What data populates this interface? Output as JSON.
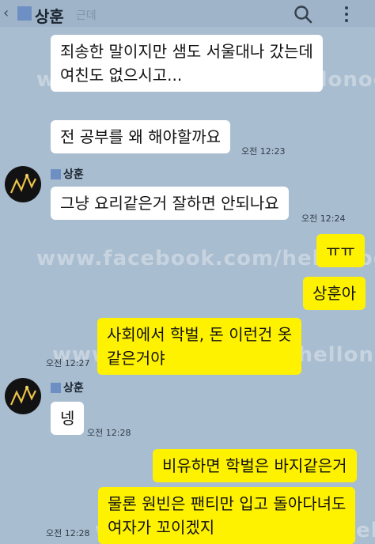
{
  "header": {
    "title": "상훈",
    "subtitle": "근데",
    "back_icon": "chevron-left-icon",
    "search_icon": "search-icon",
    "menu_icon": "more-vertical-icon"
  },
  "watermark": "www.facebook.com/hellonodap",
  "messages": [
    {
      "side": "left",
      "lines": [
        "죄송한 말이지만 샘도 서울대나 갔는데",
        "여친도 없으시고..."
      ],
      "time": ""
    },
    {
      "side": "left",
      "lines": [
        "전 공부를 왜 해야할까요"
      ],
      "time": "오전 12:23"
    },
    {
      "side": "left",
      "sender": "상훈",
      "lines": [
        "그냥 요리같은거 잘하면 안되나요"
      ],
      "time": "오전 12:24"
    },
    {
      "side": "right",
      "lines": [
        "ㅠㅠ"
      ],
      "time": ""
    },
    {
      "side": "right",
      "lines": [
        "상훈아"
      ],
      "time": ""
    },
    {
      "side": "right",
      "lines": [
        "사회에서 학벌, 돈 이런건 옷",
        "같은거야"
      ],
      "time": "오전 12:27"
    },
    {
      "side": "left",
      "sender": "상훈",
      "lines": [
        "넹"
      ],
      "time": "오전 12:28"
    },
    {
      "side": "right",
      "lines": [
        "비유하면 학벌은 바지같은거"
      ],
      "time": ""
    },
    {
      "side": "right",
      "lines": [
        "물론 원빈은 팬티만 입고 돌아다녀도",
        "여자가 꼬이겠지"
      ],
      "time": "오전 12:28"
    }
  ],
  "colors": {
    "background": "#a9bdd0",
    "my_bubble": "#fff200",
    "their_bubble": "#ffffff"
  }
}
